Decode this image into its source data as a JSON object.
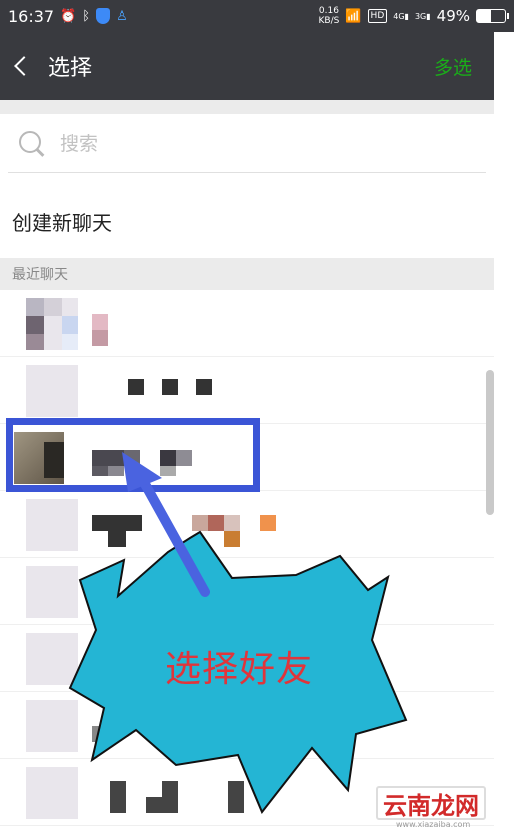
{
  "status_bar": {
    "time": "16:37",
    "net_speed_value": "0.16",
    "net_speed_unit": "KB/S",
    "hd_label": "HD",
    "signal_1": "4G",
    "signal_2": "3G",
    "battery_text": "49%",
    "battery_level": 0.49,
    "icons": [
      "alarm-icon",
      "bluetooth-icon",
      "shield-icon",
      "qq-icon",
      "wifi-icon",
      "signal-icon",
      "battery-icon"
    ]
  },
  "title_bar": {
    "title": "选择",
    "multi_select_label": "多选",
    "accent_color": "#1aad19"
  },
  "search": {
    "placeholder": "搜索"
  },
  "create_chat_label": "创建新聊天",
  "section_header": "最近聊天",
  "annotation": {
    "burst_text": "选择好友",
    "box_color": "#3b55d6",
    "burst_color": "#24b5d4",
    "text_color": "#e0353b"
  },
  "watermark": {
    "text": "云南龙网",
    "url": "www.xiazaiba.com"
  }
}
